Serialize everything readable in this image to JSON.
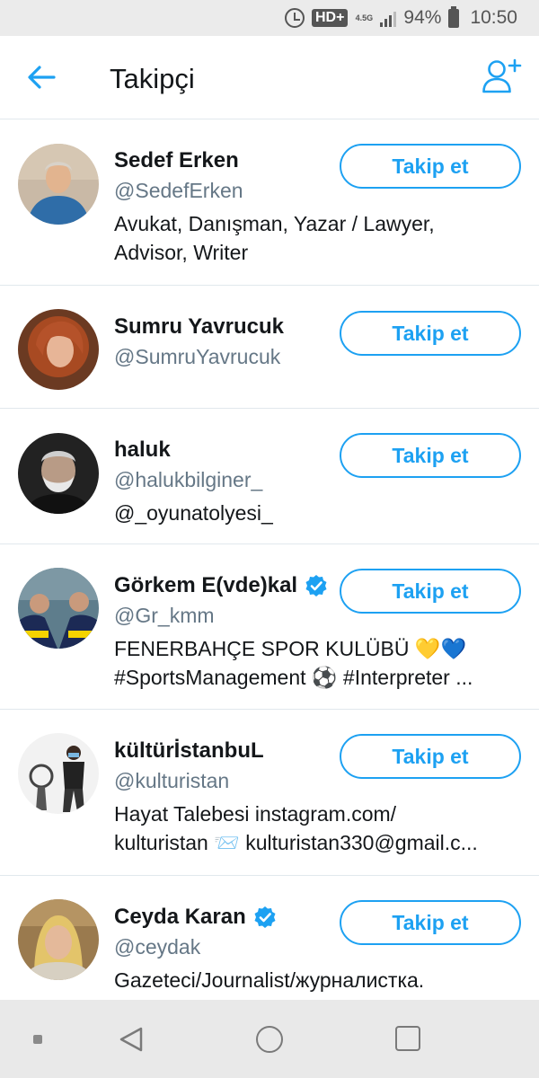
{
  "status_bar": {
    "hd_label": "HD+",
    "network_label": "4.5G",
    "battery": "94%",
    "time": "10:50"
  },
  "header": {
    "title": "Takipçi"
  },
  "users": [
    {
      "name": "Sedef Erken",
      "handle": "@SedefErken",
      "verified": false,
      "bio_lines": [
        "Avukat, Danışman, Yazar / Lawyer,",
        "Advisor, Writer"
      ],
      "follow_label": "Takip et"
    },
    {
      "name": "Sumru Yavrucuk",
      "handle": "@SumruYavrucuk",
      "verified": false,
      "bio_lines": [],
      "follow_label": "Takip et"
    },
    {
      "name": "haluk",
      "handle": "@halukbilginer_",
      "verified": false,
      "bio_lines": [
        "@_oyunatolyesi_"
      ],
      "follow_label": "Takip et"
    },
    {
      "name": "Görkem E(vde)kal",
      "handle": "@Gr_kmm",
      "verified": true,
      "bio_lines": [
        "FENERBAHÇE SPOR KULÜBÜ 💛💙",
        "#SportsManagement ⚽ #Interpreter ..."
      ],
      "follow_label": "Takip et"
    },
    {
      "name": "kültürİstanbuL",
      "handle": "@kulturistan",
      "verified": false,
      "bio_lines": [
        "Hayat Talebesi instagram.com/",
        "kulturistan 📨 kulturistan330@gmail.c..."
      ],
      "follow_label": "Takip et"
    },
    {
      "name": "Ceyda Karan",
      "handle": "@ceydak",
      "verified": true,
      "bio_lines": [
        "Gazeteci/Journalist/журналистка."
      ],
      "follow_label": "Takip et"
    }
  ]
}
